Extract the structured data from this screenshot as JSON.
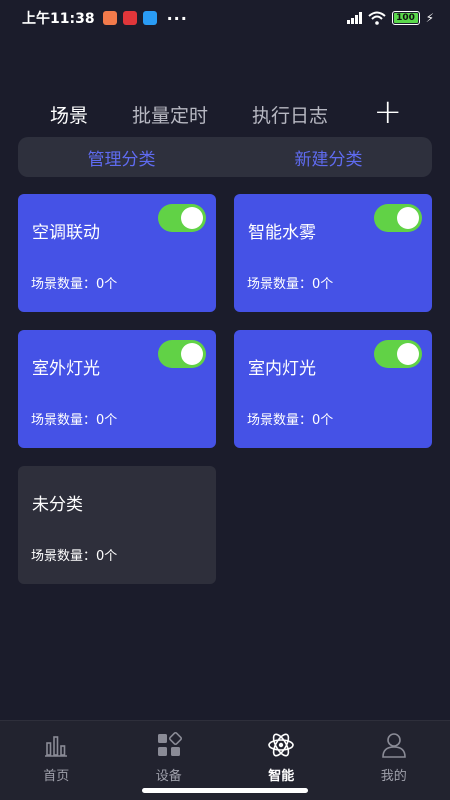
{
  "status_bar": {
    "time": "上午11:38",
    "dots": "···",
    "battery": "100",
    "app_icons": [
      {
        "name": "app-icon-1",
        "color": "#f27a4b"
      },
      {
        "name": "app-icon-2",
        "color": "#e0363a"
      },
      {
        "name": "app-icon-3",
        "color": "#2a9cf5"
      }
    ]
  },
  "tabs": [
    {
      "label": "场景",
      "active": true
    },
    {
      "label": "批量定时",
      "active": false
    },
    {
      "label": "执行日志",
      "active": false
    }
  ],
  "add_label": "+",
  "category_bar": {
    "manage": "管理分类",
    "create": "新建分类"
  },
  "cards": [
    {
      "title": "空调联动",
      "count": "场景数量：0个",
      "toggle_on": true
    },
    {
      "title": "智能水雾",
      "count": "场景数量：0个",
      "toggle_on": true
    },
    {
      "title": "室外灯光",
      "count": "场景数量：0个",
      "toggle_on": true
    },
    {
      "title": "室内灯光",
      "count": "场景数量：0个",
      "toggle_on": true
    },
    {
      "title": "未分类",
      "count": "场景数量：0个",
      "toggle_on": false
    }
  ],
  "bottom_nav": [
    {
      "label": "首页",
      "icon": "bar-chart-icon",
      "active": false
    },
    {
      "label": "设备",
      "icon": "devices-icon",
      "active": false
    },
    {
      "label": "智能",
      "icon": "atom-icon",
      "active": true
    },
    {
      "label": "我的",
      "icon": "user-icon",
      "active": false
    }
  ],
  "colors": {
    "background": "#1b1c2b",
    "card_blue": "#4552e6",
    "card_grey": "#2e2f3b",
    "toggle_green": "#61d246",
    "accent": "#5f6bf0"
  }
}
